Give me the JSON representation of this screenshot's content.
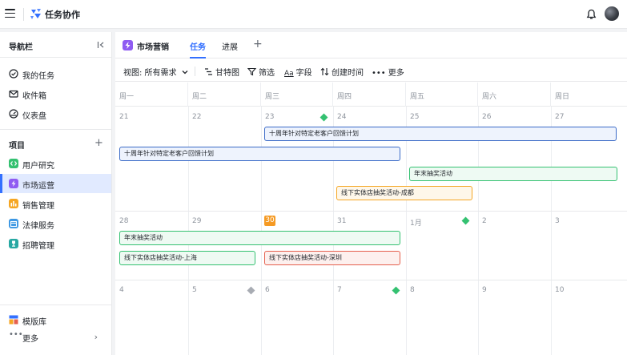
{
  "app": {
    "title": "任务协作"
  },
  "sidebar": {
    "title": "导航栏",
    "items": [
      {
        "label": "我的任务",
        "icon": "check-circle-icon"
      },
      {
        "label": "收件箱",
        "icon": "mail-icon"
      },
      {
        "label": "仪表盘",
        "icon": "dashboard-icon"
      }
    ],
    "section_title": "项目",
    "projects": [
      {
        "label": "用户研究",
        "color": "#34c171",
        "icon": "code-icon"
      },
      {
        "label": "市场运营",
        "color": "#8f5cf2",
        "icon": "lightning-icon"
      },
      {
        "label": "销售管理",
        "color": "#f5a623",
        "icon": "chart-icon"
      },
      {
        "label": "法律服务",
        "color": "#3b97e3",
        "icon": "calendar-icon"
      },
      {
        "label": "招聘管理",
        "color": "#27a8a3",
        "icon": "trophy-icon"
      }
    ],
    "template_label": "模版库",
    "more_label": "更多"
  },
  "main": {
    "project_title": "市场营销",
    "tabs": [
      {
        "label": "任务"
      },
      {
        "label": "进展"
      }
    ],
    "toolbar": {
      "view": "视图: 所有需求",
      "gantt": "甘特图",
      "filter": "筛选",
      "fields": "字段",
      "created": "创建时间",
      "more": "更多"
    }
  },
  "calendar": {
    "weekdays": [
      "周一",
      "周二",
      "周三",
      "周四",
      "周五",
      "周六",
      "周日"
    ],
    "weeks": [
      [
        "21",
        "22",
        "23",
        "24",
        "25",
        "26",
        "27"
      ],
      [
        "28",
        "29",
        "30",
        "31",
        "1月",
        "2",
        "3"
      ],
      [
        "4",
        "5",
        "6",
        "7",
        "8",
        "9",
        "10"
      ]
    ],
    "today": "30",
    "events": [
      {
        "title": "十周年针对特定老客户回馈计划",
        "color": "blue"
      },
      {
        "title": "十周年针对特定老客户回馈计划",
        "color": "blue"
      },
      {
        "title": "年末抽奖活动",
        "color": "green"
      },
      {
        "title": "线下实体店抽奖活动-成都",
        "color": "orange"
      },
      {
        "title": "年末抽奖活动",
        "color": "green"
      },
      {
        "title": "线下实体店抽奖活动-上海",
        "color": "green"
      },
      {
        "title": "线下实体店抽奖活动-深圳",
        "color": "red"
      }
    ]
  }
}
